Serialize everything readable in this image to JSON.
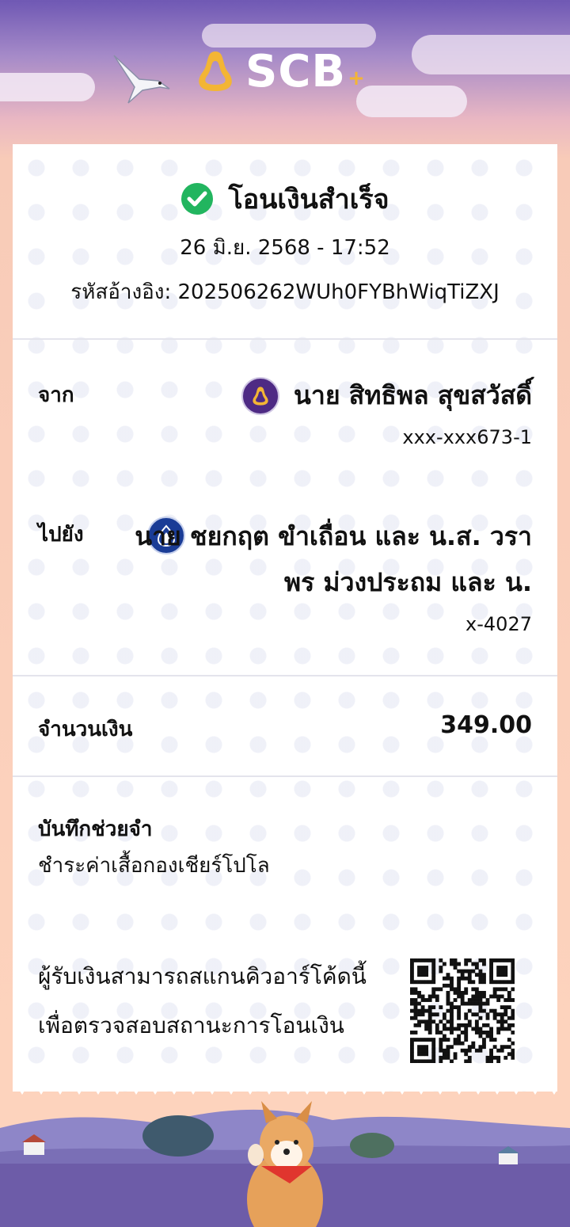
{
  "brand": {
    "name": "SCB",
    "plus": "+"
  },
  "status": {
    "title": "โอนเงินสำเร็จ",
    "datetime": "26 มิ.ย. 2568 - 17:52",
    "ref_label": "รหัสอ้างอิง:",
    "ref_value": "202506262WUh0FYBhWiqTiZXJ"
  },
  "from": {
    "label": "จาก",
    "name": "นาย สิทธิพล สุขสวัสดิ์",
    "account": "xxx-xxx673-1"
  },
  "to": {
    "label": "ไปยัง",
    "name": "นาย ชยกฤต ขำเถื่อน และ น.ส. วราพร ม่วงประถม และ น.",
    "account": "x-4027"
  },
  "amount": {
    "label": "จำนวนเงิน",
    "value": "349.00"
  },
  "memo": {
    "label": "บันทึกช่วยจำ",
    "text": "ชำระค่าเสื้อกองเชียร์โปโล"
  },
  "qr_note": "ผู้รับเงินสามารถสแกนคิวอาร์โค้ดนี้เพื่อตรวจสอบสถานะการโอนเงิน",
  "colors": {
    "scb_purple": "#4e2a84",
    "scb_gold": "#f3b535",
    "success_green": "#22b55f",
    "bbl_blue": "#1a3c96"
  }
}
